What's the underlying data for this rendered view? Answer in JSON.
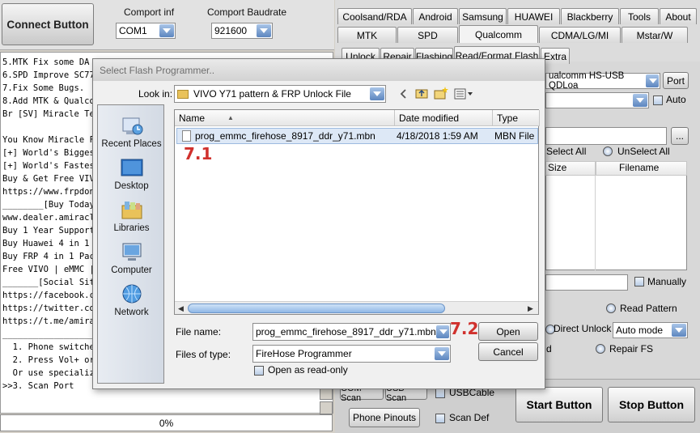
{
  "app": {
    "connect_button": "Connect Button",
    "comport_label": "Comport inf",
    "comport_value": "COM1",
    "baud_label": "Comport Baudrate",
    "baud_value": "921600",
    "log_lines": [
      "5.MTK Fix some DA i",
      "6.SPD Improve SC772",
      "7.Fix Some Bugs.",
      "8.Add MTK & Qualcom",
      "Br [SV] Miracle Tea",
      "",
      "You Know Miracle FR",
      "[+] World's Biggest",
      "[+] World's Fastest",
      "Buy & Get Free VIVO",
      "https://www.frpdong",
      "________[Buy Today",
      "www.dealer.amiracle",
      "Buy 1 Year Support",
      "Buy Huawei 4 in 1 F",
      "Buy FRP 4 in 1 Pack",
      "Free VIVO | eMMC |",
      "_______[Social Sit",
      "https://facebook.co",
      "https://twitter.com",
      "https://t.me/amirac",
      "________________________",
      "  1. Phone switched",
      "  2. Press Vol+ or",
      "  Or use specialize",
      ">>3. Scan Port"
    ],
    "progress": "0%"
  },
  "tabs_row1": [
    "Coolsand/RDA",
    "Android",
    "Samsung",
    "HUAWEI",
    "Blackberry",
    "Tools",
    "About"
  ],
  "tabs_row2": [
    "MTK",
    "SPD",
    "Qualcomm",
    "CDMA/LG/MI",
    "Mstar/W"
  ],
  "tabs_row3": [
    "Unlock",
    "Repair",
    "Flashing",
    "Read/Format Flash",
    "Extra"
  ],
  "right": {
    "port_combo": "ualcomm HS-USB QDLoa",
    "port_button": "Port",
    "auto_label": "Auto",
    "browse_button": "...",
    "select_all": "Select All",
    "unselect_all": "UnSelect All",
    "col_size": "Size",
    "col_filename": "Filename",
    "manually_label": "Manually",
    "read_pattern": "Read Pattern",
    "direct_unlock": "Direct Unlock",
    "auto_mode": "Auto mode",
    "d_label": "d",
    "repair_fs": "Repair FS",
    "com_scan": "COM Scan",
    "usb_scan": "USB Scan",
    "usb_cable": "USBCable",
    "phone_pinouts": "Phone Pinouts",
    "scan_def": "Scan Def",
    "start_button": "Start Button",
    "stop_button": "Stop Button"
  },
  "dialog": {
    "title": "Select Flash Programmer..",
    "look_in_label": "Look in:",
    "look_in_value": "VIVO Y71 pattern & FRP Unlock File",
    "places": [
      "Recent Places",
      "Desktop",
      "Libraries",
      "Computer",
      "Network"
    ],
    "columns": [
      "Name",
      "Date modified",
      "Type"
    ],
    "files": [
      {
        "name": "prog_emmc_firehose_8917_ddr_y71.mbn",
        "date": "4/18/2018 1:59 AM",
        "type": "MBN File"
      }
    ],
    "file_name_label": "File name:",
    "file_name_value": "prog_emmc_firehose_8917_ddr_y71.mbn",
    "files_of_type_label": "Files of type:",
    "files_of_type_value": "FireHose Programmer",
    "open_button": "Open",
    "cancel_button": "Cancel",
    "readonly_label": "Open as read-only",
    "annotation_1": "7.1",
    "annotation_2": "7.2"
  },
  "colors": {
    "annotation": "#d0312d",
    "accent": "#5d86bf"
  }
}
